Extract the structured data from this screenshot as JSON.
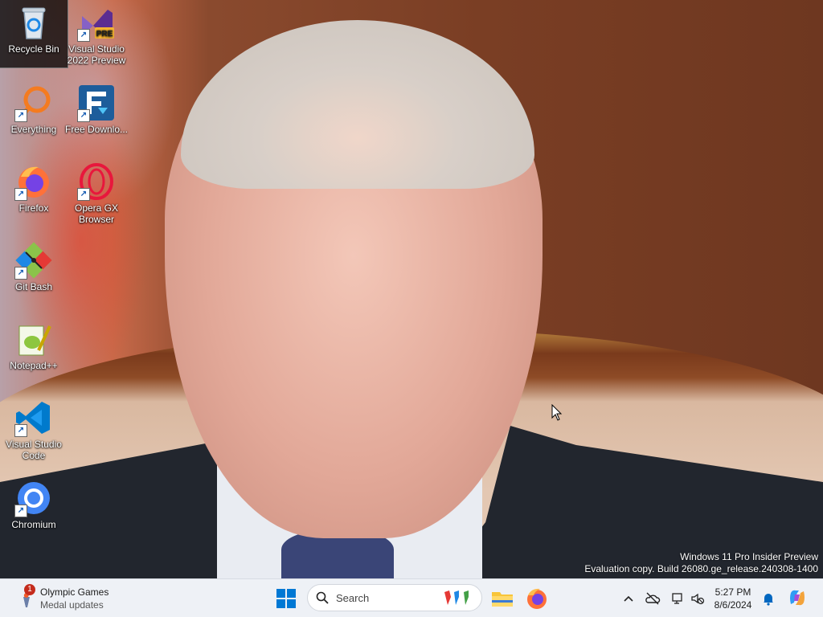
{
  "desktop": {
    "icons": [
      {
        "label": "Recycle Bin",
        "icon": "recycle-bin-icon"
      },
      {
        "label": "Visual Studio 2022 Preview",
        "icon": "visual-studio-preview-icon",
        "badge": "PRE"
      },
      {
        "label": "Everything",
        "icon": "everything-search-icon"
      },
      {
        "label": "Free Downlo...",
        "icon": "free-download-manager-icon"
      },
      {
        "label": "Firefox",
        "icon": "firefox-icon"
      },
      {
        "label": "Opera GX Browser",
        "icon": "opera-gx-icon"
      },
      {
        "label": "Git Bash",
        "icon": "git-bash-icon"
      },
      {
        "label": "Notepad++",
        "icon": "notepad-plus-plus-icon"
      },
      {
        "label": "Visual Studio Code",
        "icon": "vscode-icon"
      },
      {
        "label": "Chromium",
        "icon": "chromium-icon"
      }
    ]
  },
  "watermark": {
    "line1": "Windows 11 Pro Insider Preview",
    "line2": "Evaluation copy. Build 26080.ge_release.240308-1400"
  },
  "taskbar": {
    "widget": {
      "badge": "1",
      "title": "Olympic Games",
      "subtitle": "Medal updates"
    },
    "search": {
      "placeholder": "Search"
    },
    "clock": {
      "time": "5:27 PM",
      "date": "8/6/2024"
    }
  },
  "colors": {
    "taskbar_bg": "#eef1f6",
    "accent": "#0067c0",
    "badge": "#c42b1c"
  }
}
